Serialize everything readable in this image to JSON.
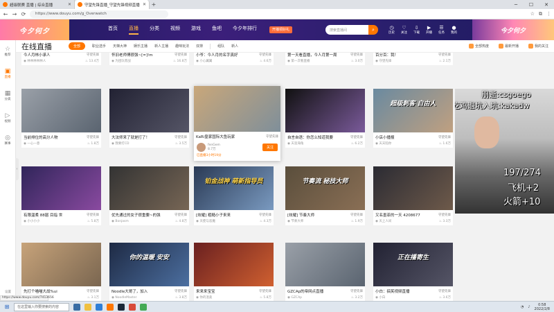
{
  "browser": {
    "tabs": [
      {
        "title": "超级联赛 直播 | 综合直播",
        "active": false
      },
      {
        "title": "守望先锋直播_守望先锋视频直播",
        "active": true
      }
    ],
    "new_tab": "+",
    "url": "https://www.douyu.com/g_Overwatch",
    "window_controls": [
      "─",
      "☐",
      "✕"
    ]
  },
  "header": {
    "logo_text": "今夕何夕",
    "nav": [
      "首页",
      "直播",
      "分类",
      "视频",
      "游戏",
      "鱼吧",
      "今夕年排行"
    ],
    "active_nav": "直播",
    "promo_button": "开播领好礼",
    "search_placeholder": "搜索直播间",
    "search_icon": "⌕",
    "icons": [
      {
        "name": "history-icon",
        "glyph": "◷",
        "label": "历史"
      },
      {
        "name": "follow-icon",
        "glyph": "♡",
        "label": "关注"
      },
      {
        "name": "download-icon",
        "glyph": "⇩",
        "label": "下载"
      },
      {
        "name": "live-icon",
        "glyph": "▶",
        "label": "开播"
      },
      {
        "name": "task-icon",
        "glyph": "☰",
        "label": "任务"
      },
      {
        "name": "avatar-icon",
        "glyph": "●",
        "label": "我的"
      }
    ],
    "banner_text": "今夕何夕"
  },
  "sidebar": {
    "items": [
      {
        "name": "sidebar-item-recommend",
        "glyph": "☆",
        "label": "推荐",
        "active": false
      },
      {
        "name": "sidebar-item-live",
        "glyph": "▣",
        "label": "直播",
        "active": true
      },
      {
        "name": "sidebar-item-category",
        "glyph": "▦",
        "label": "分类",
        "active": false
      },
      {
        "name": "sidebar-item-video",
        "glyph": "▷",
        "label": "视频",
        "active": false
      },
      {
        "name": "sidebar-item-esports",
        "glyph": "◎",
        "label": "赛事",
        "active": false
      }
    ],
    "collapse": "‹",
    "bottom": "设置"
  },
  "filterbar": {
    "title": "在线直播",
    "chips": [
      "全部",
      "职业选手",
      "天梯大神",
      "娱乐主播",
      "新人主播",
      "趣味玩法",
      "双排",
      "组队",
      "新人"
    ],
    "right": [
      "全部热度",
      "最新开播",
      "我的关注"
    ]
  },
  "hover_card": {
    "title": "KaRi皇家国际大鱼玩家",
    "streamer": "fenGem",
    "count": "8.7万",
    "follow": "关注",
    "time": "已直播3小时19分",
    "game": "守望先锋"
  },
  "cards": [
    {
      "title": "今人月林小承人",
      "game": "守望先锋",
      "streamer": "林林林林林人",
      "count": "13.4万"
    },
    {
      "title": "怀旧老师傅很强~[=]!m",
      "game": "守望先锋",
      "streamer": "为团队而战",
      "count": "16.8万"
    },
    {
      "title": "小爷：今人月的名字真好",
      "game": "守望先锋",
      "streamer": "小心翼翼",
      "count": "4.6万"
    },
    {
      "title": "第一天看直播，今人月第一周",
      "game": "守望先锋",
      "streamer": "第一次看直播",
      "count": "3.0万"
    },
    {
      "title": "百分百：我！",
      "game": "守望先锋",
      "streamer": "守望先锋",
      "count": "2.1万"
    },
    {
      "title": "当前排位的高分人物",
      "game": "守望先锋",
      "streamer": "一心一意",
      "count": "1.8万"
    },
    {
      "title": "大法师来了就是打了！",
      "game": "守望先锋",
      "streamer": "我要打CD",
      "count": "3.5万"
    },
    {
      "title": "自言自语：你怎么知道我要",
      "game": "守望先锋",
      "streamer": "天涯海角",
      "count": "6.2万"
    },
    {
      "title": "小店小播报",
      "game": "守望先锋",
      "streamer": "天天陪你",
      "count": "1.6万"
    },
    {
      "title": "有限温柔 88届 目指 世",
      "game": "守望先锋",
      "streamer": "小小小小",
      "count": "5.8万"
    },
    {
      "title": "优先通过的女子很重要~的强",
      "game": "守望先锋",
      "streamer": "Bonjasm",
      "count": "4.8万"
    },
    {
      "title": "[炫耀] 粗糙小子来来",
      "game": "守望先锋",
      "streamer": "天使与恶魔",
      "count": "4.3万"
    },
    {
      "title": "[炫耀] 节奏大师",
      "game": "守望先锋",
      "streamer": "节奏大师",
      "count": "1.9万"
    },
    {
      "title": "又名墨菲的一天 4208677",
      "game": "守望先锋",
      "streamer": "天上人间",
      "count": "3.3万"
    },
    {
      "title": "先打个喵喵大战%ui",
      "game": "守望先锋",
      "streamer": "我叫天使",
      "count": "3.1万"
    },
    {
      "title": "Noodle大哥了，加入",
      "game": "守望先锋",
      "streamer": "NoodleMaster",
      "count": "3.8万"
    },
    {
      "title": "来来来宝宝",
      "game": "守望先锋",
      "streamer": "你的温柔",
      "count": "5.8万"
    },
    {
      "title": "GZCAp的帝网点直播",
      "game": "守望先锋",
      "streamer": "GZCAp",
      "count": "3.2万"
    },
    {
      "title": "小白：搞笑视频直播",
      "game": "守望先锋",
      "streamer": "小白",
      "count": "3.6万"
    },
    {
      "title": "[炫] 凌晨一点，期待新人",
      "game": "守望先锋",
      "streamer": "大神",
      "count": "2.9万"
    },
    {
      "title": "专注天梯上分",
      "game": "守望先锋",
      "streamer": "天梯上分",
      "count": "1.3万"
    },
    {
      "title": "[炸裂] 新的赛季",
      "game": "守望先锋",
      "streamer": "炸裂",
      "count": "2.4万"
    }
  ],
  "thumb_overlays": [
    "铂金战神 萌新指导员",
    "节奏流 秘技大师",
    "超级刺客 自由人",
    "你的温暖 安安",
    "正在播寄生"
  ],
  "stream_overlay": {
    "line1": "朋逝:csgoego",
    "line2": "吃鸡退坑入坑:kakadw",
    "line3": "197/274",
    "line4": "飞机+2",
    "line5": "火箭+10"
  },
  "status_url": "https://www.douyu.com/7413656",
  "taskbar": {
    "start": "⊞",
    "search_placeholder": "在这里输入你要搜索的内容",
    "time": "0:58",
    "date": "2022/2/8"
  }
}
